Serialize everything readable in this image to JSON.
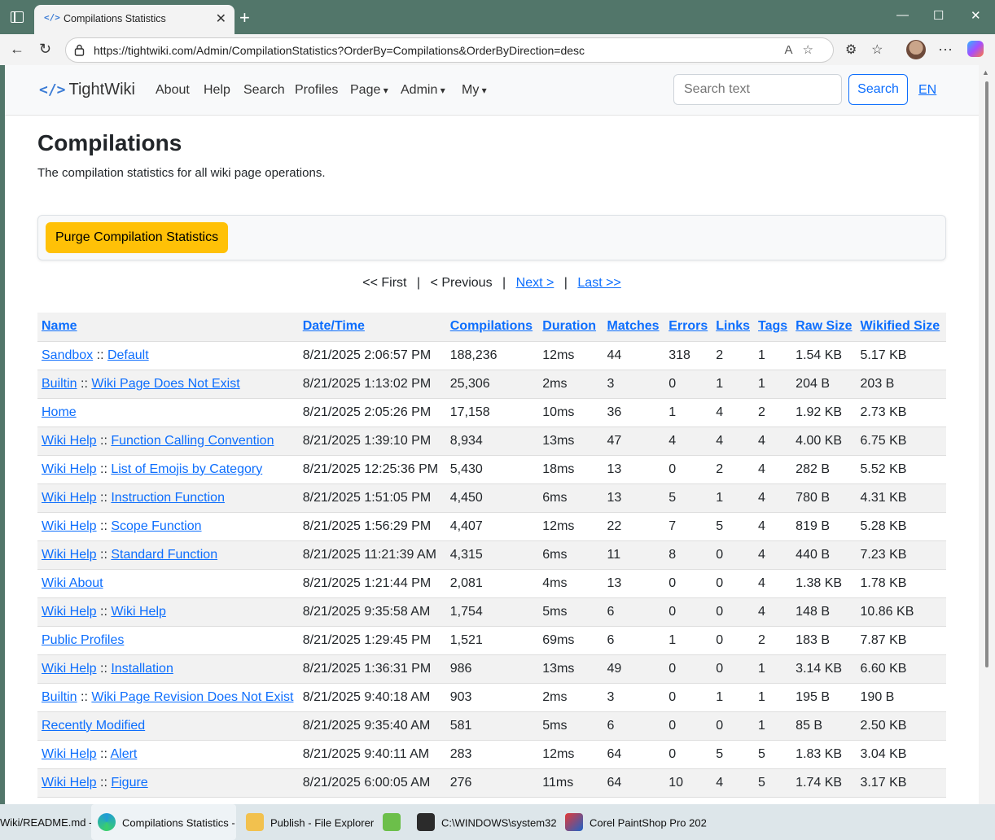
{
  "browser": {
    "tab_title": "Compilations Statistics",
    "url": "https://tightwiki.com/Admin/CompilationStatistics?OrderBy=Compilations&OrderByDirection=desc"
  },
  "navbar": {
    "brand": "TightWiki",
    "links": [
      "About",
      "Help",
      "Search",
      "Profiles"
    ],
    "dropdowns": [
      "Page",
      "Admin",
      "My"
    ],
    "search_placeholder": "Search text",
    "search_button": "Search",
    "language": "EN"
  },
  "page": {
    "title": "Compilations",
    "subtitle": "The compilation statistics for all wiki page operations.",
    "purge_button": "Purge Compilation Statistics"
  },
  "pager": {
    "first": "<< First",
    "previous": "< Previous",
    "next": "Next >",
    "last": "Last >>"
  },
  "table": {
    "headers": [
      "Name",
      "Date/Time",
      "Compilations",
      "Duration",
      "Matches",
      "Errors",
      "Links",
      "Tags",
      "Raw Size",
      "Wikified Size"
    ],
    "rows": [
      {
        "ns": "Sandbox",
        "name": "Default",
        "date": "8/21/2025 2:06:57 PM",
        "compilations": "188,236",
        "duration": "12ms",
        "matches": "44",
        "errors": "318",
        "links": "2",
        "tags": "1",
        "raw": "1.54 KB",
        "wikified": "5.17 KB"
      },
      {
        "ns": "Builtin",
        "name": "Wiki Page Does Not Exist",
        "date": "8/21/2025 1:13:02 PM",
        "compilations": "25,306",
        "duration": "2ms",
        "matches": "3",
        "errors": "0",
        "links": "1",
        "tags": "1",
        "raw": "204 B",
        "wikified": "203 B"
      },
      {
        "ns": "",
        "name": "Home",
        "date": "8/21/2025 2:05:26 PM",
        "compilations": "17,158",
        "duration": "10ms",
        "matches": "36",
        "errors": "1",
        "links": "4",
        "tags": "2",
        "raw": "1.92 KB",
        "wikified": "2.73 KB"
      },
      {
        "ns": "Wiki Help",
        "name": "Function Calling Convention",
        "date": "8/21/2025 1:39:10 PM",
        "compilations": "8,934",
        "duration": "13ms",
        "matches": "47",
        "errors": "4",
        "links": "4",
        "tags": "4",
        "raw": "4.00 KB",
        "wikified": "6.75 KB"
      },
      {
        "ns": "Wiki Help",
        "name": "List of Emojis by Category",
        "date": "8/21/2025 12:25:36 PM",
        "compilations": "5,430",
        "duration": "18ms",
        "matches": "13",
        "errors": "0",
        "links": "2",
        "tags": "4",
        "raw": "282 B",
        "wikified": "5.52 KB"
      },
      {
        "ns": "Wiki Help",
        "name": "Instruction Function",
        "date": "8/21/2025 1:51:05 PM",
        "compilations": "4,450",
        "duration": "6ms",
        "matches": "13",
        "errors": "5",
        "links": "1",
        "tags": "4",
        "raw": "780 B",
        "wikified": "4.31 KB"
      },
      {
        "ns": "Wiki Help",
        "name": "Scope Function",
        "date": "8/21/2025 1:56:29 PM",
        "compilations": "4,407",
        "duration": "12ms",
        "matches": "22",
        "errors": "7",
        "links": "5",
        "tags": "4",
        "raw": "819 B",
        "wikified": "5.28 KB"
      },
      {
        "ns": "Wiki Help",
        "name": "Standard Function",
        "date": "8/21/2025 11:21:39 AM",
        "compilations": "4,315",
        "duration": "6ms",
        "matches": "11",
        "errors": "8",
        "links": "0",
        "tags": "4",
        "raw": "440 B",
        "wikified": "7.23 KB"
      },
      {
        "ns": "",
        "name": "Wiki About",
        "date": "8/21/2025 1:21:44 PM",
        "compilations": "2,081",
        "duration": "4ms",
        "matches": "13",
        "errors": "0",
        "links": "0",
        "tags": "4",
        "raw": "1.38 KB",
        "wikified": "1.78 KB"
      },
      {
        "ns": "Wiki Help",
        "name": "Wiki Help",
        "date": "8/21/2025 9:35:58 AM",
        "compilations": "1,754",
        "duration": "5ms",
        "matches": "6",
        "errors": "0",
        "links": "0",
        "tags": "4",
        "raw": "148 B",
        "wikified": "10.86 KB"
      },
      {
        "ns": "",
        "name": "Public Profiles",
        "date": "8/21/2025 1:29:45 PM",
        "compilations": "1,521",
        "duration": "69ms",
        "matches": "6",
        "errors": "1",
        "links": "0",
        "tags": "2",
        "raw": "183 B",
        "wikified": "7.87 KB"
      },
      {
        "ns": "Wiki Help",
        "name": "Installation",
        "date": "8/21/2025 1:36:31 PM",
        "compilations": "986",
        "duration": "13ms",
        "matches": "49",
        "errors": "0",
        "links": "0",
        "tags": "1",
        "raw": "3.14 KB",
        "wikified": "6.60 KB"
      },
      {
        "ns": "Builtin",
        "name": "Wiki Page Revision Does Not Exist",
        "date": "8/21/2025 9:40:18 AM",
        "compilations": "903",
        "duration": "2ms",
        "matches": "3",
        "errors": "0",
        "links": "1",
        "tags": "1",
        "raw": "195 B",
        "wikified": "190 B"
      },
      {
        "ns": "",
        "name": "Recently Modified",
        "date": "8/21/2025 9:35:40 AM",
        "compilations": "581",
        "duration": "5ms",
        "matches": "6",
        "errors": "0",
        "links": "0",
        "tags": "1",
        "raw": "85 B",
        "wikified": "2.50 KB"
      },
      {
        "ns": "Wiki Help",
        "name": "Alert",
        "date": "8/21/2025 9:40:11 AM",
        "compilations": "283",
        "duration": "12ms",
        "matches": "64",
        "errors": "0",
        "links": "5",
        "tags": "5",
        "raw": "1.83 KB",
        "wikified": "3.04 KB"
      },
      {
        "ns": "Wiki Help",
        "name": "Figure",
        "date": "8/21/2025 6:00:05 AM",
        "compilations": "276",
        "duration": "11ms",
        "matches": "64",
        "errors": "10",
        "links": "4",
        "tags": "5",
        "raw": "1.74 KB",
        "wikified": "3.17 KB"
      }
    ]
  },
  "taskbar": {
    "items": [
      "Wiki/README.md -",
      "Compilations Statistics -",
      "Publish - File Explorer",
      "",
      "C:\\WINDOWS\\system32",
      "Corel PaintShop Pro 202"
    ]
  }
}
